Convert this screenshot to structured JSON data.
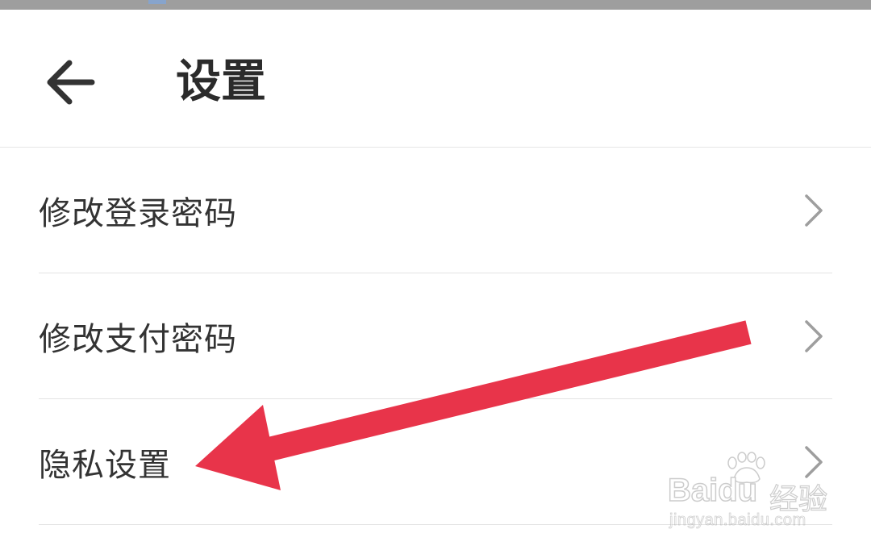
{
  "header": {
    "title": "设置",
    "back_icon": "arrow-left-icon"
  },
  "settings": {
    "items": [
      {
        "label": "修改登录密码",
        "icon": "chevron-right-icon"
      },
      {
        "label": "修改支付密码",
        "icon": "chevron-right-icon"
      },
      {
        "label": "隐私设置",
        "icon": "chevron-right-icon"
      }
    ]
  },
  "annotation": {
    "arrow_color": "#e8344a",
    "arrow_target": "隐私设置"
  },
  "watermark": {
    "brand": "Baidu",
    "brand_cn": "经验",
    "url": "jingyan.baidu.com"
  },
  "colors": {
    "background": "#ffffff",
    "text": "#333333",
    "divider": "#e3e3e3",
    "chevron": "#9e9e9e"
  }
}
